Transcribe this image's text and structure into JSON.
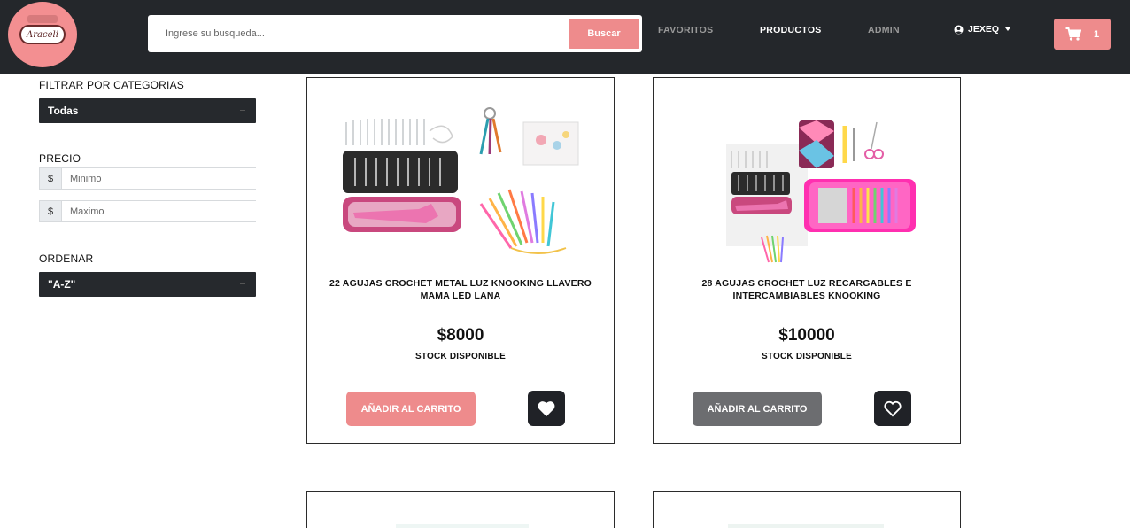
{
  "brand": {
    "logo_text": "Araceli"
  },
  "header": {
    "search_placeholder": "Ingrese su busqueda...",
    "search_button": "Buscar",
    "nav": [
      {
        "label": "FAVORITOS",
        "active": false
      },
      {
        "label": "PRODUCTOS",
        "active": true
      },
      {
        "label": "ADMIN",
        "active": false
      }
    ],
    "user": "JEXEQ",
    "cart_count": "1",
    "accent_color": "#ee8b8c",
    "bar_color": "#24272b"
  },
  "sidebar": {
    "filter_label": "FILTRAR POR CATEGORIAS",
    "category_selected": "Todas",
    "price_label": "PRECIO",
    "currency_symbol": "$",
    "min_placeholder": "Minimo",
    "max_placeholder": "Maximo",
    "order_label": "ORDENAR",
    "order_selected": "\"A-Z\""
  },
  "products": [
    {
      "title": "22 AGUJAS CROCHET METAL LUZ KNOOKING LLAVERO MAMA LED LANA",
      "price": "$8000",
      "stock": "STOCK DISPONIBLE",
      "add_label": "AÑADIR AL CARRITO",
      "favorite": true,
      "image_icon": "crochet-kit-image"
    },
    {
      "title": "28 AGUJAS CROCHET LUZ RECARGABLES E INTERCAMBIABLES KNOOKING",
      "price": "$10000",
      "stock": "STOCK DISPONIBLE",
      "add_label": "AÑADIR AL CARRITO",
      "favorite": false,
      "image_icon": "crochet-case-image"
    }
  ]
}
